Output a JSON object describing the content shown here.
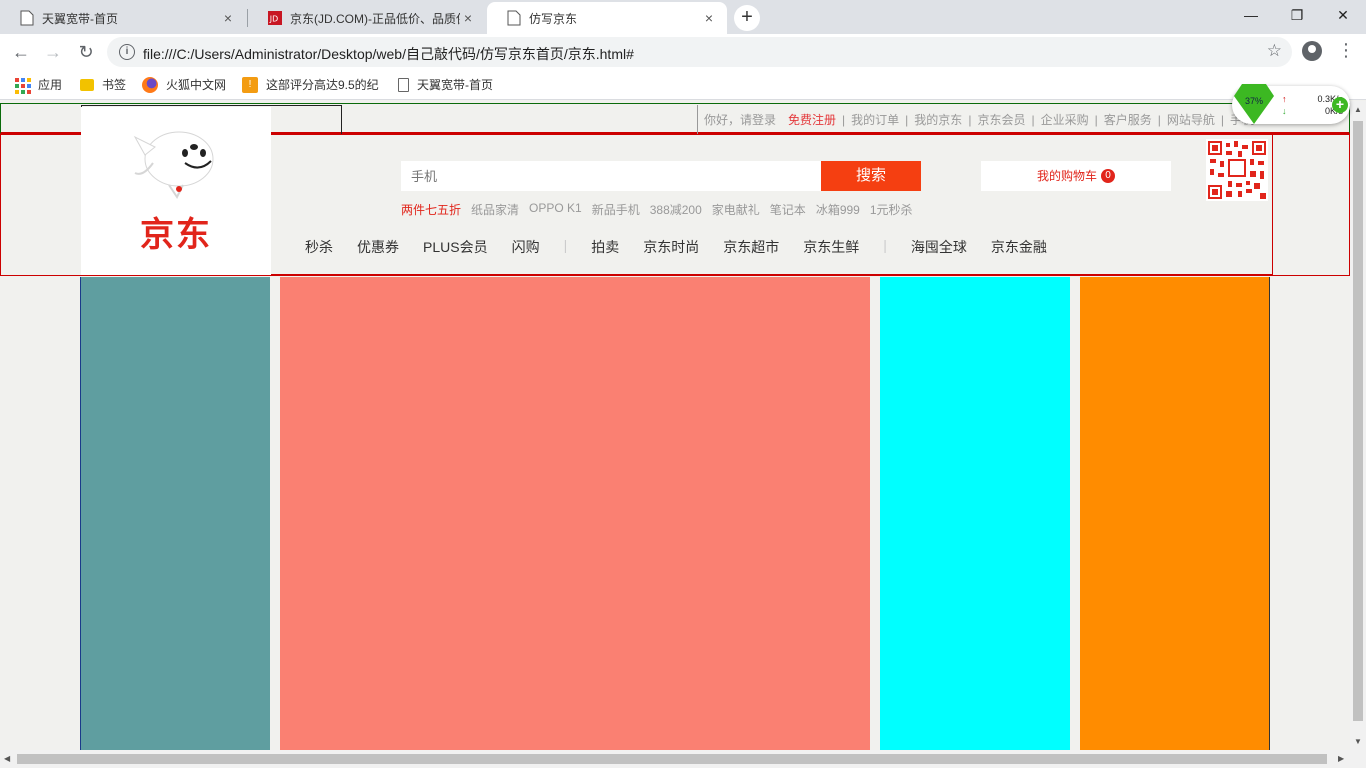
{
  "browser": {
    "tabs": [
      {
        "title": "天翼宽带-首页",
        "favicon": "page-icon"
      },
      {
        "title": "京东(JD.COM)-正品低价、品质保障、配送及时、轻松购物！",
        "favicon": "jd-favicon"
      },
      {
        "title": "仿写京东",
        "favicon": "page-icon"
      }
    ],
    "active_tab": 2,
    "new_tab_label": "+",
    "close_glyph": "×",
    "window_controls": {
      "minimize": "—",
      "restore": "❐",
      "close": "✕"
    },
    "url": "file:///C:/Users/Administrator/Desktop/web/自己敲代码/仿写京东首页/京东.html#",
    "bookmarks": [
      {
        "label": "应用",
        "icon": "apps-grid-icon"
      },
      {
        "label": "书签",
        "icon": "folder-icon"
      },
      {
        "label": "火狐中文网",
        "icon": "firefox-icon"
      },
      {
        "label": "这部评分高达9.5的纪",
        "icon": "douban-book-icon"
      },
      {
        "label": "天翼宽带-首页",
        "icon": "page-icon"
      }
    ]
  },
  "widget": {
    "percent": "37%",
    "up_speed": "0.3K/s",
    "down_speed": "0K/s"
  },
  "page": {
    "shortcut": {
      "greeting": "你好，请登录",
      "register": "免费注册",
      "separator": "|",
      "links": [
        "我的订单",
        "我的京东",
        "京东会员",
        "企业采购",
        "客户服务",
        "网站导航",
        "手机"
      ]
    },
    "logo_text": "京东",
    "search": {
      "placeholder": "手机",
      "button": "搜索"
    },
    "cart": {
      "label": "我的购物车",
      "count": "0"
    },
    "hotwords": [
      "两件七五折",
      "纸品家清",
      "OPPO K1",
      "新品手机",
      "388减200",
      "家电献礼",
      "笔记本",
      "冰箱999",
      "1元秒杀"
    ],
    "navs": [
      "秒杀",
      "优惠券",
      "PLUS会员",
      "闪购",
      "|",
      "拍卖",
      "京东时尚",
      "京东超市",
      "京东生鲜",
      "|",
      "海囤全球",
      "京东金融"
    ],
    "columns": [
      {
        "name": "column-cadetblue",
        "color": "#5f9ea0"
      },
      {
        "name": "column-salmon",
        "color": "#fa8072"
      },
      {
        "name": "column-cyan",
        "color": "#00ffff"
      },
      {
        "name": "column-orange",
        "color": "#ff8c00"
      }
    ]
  }
}
